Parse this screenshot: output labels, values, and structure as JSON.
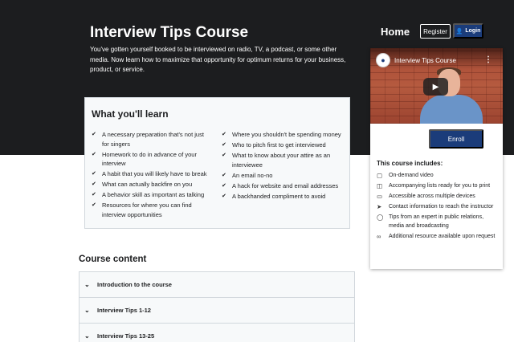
{
  "hero": {
    "title": "Interview Tips Course",
    "description": "You've gotten yourself booked to be interviewed on radio, TV, a podcast, or some other media. Now learn how to maximize that opportunity for optimum returns for your business, product, or service."
  },
  "nav": {
    "home": "Home",
    "register": "Register",
    "login": "Login"
  },
  "learn": {
    "title": "What you'll learn",
    "left": [
      "A necessary preparation that's not just for singers",
      "Homework to do in advance of your interview",
      "A habit that you will likely have to break",
      "What can actually backfire on you",
      "A behavior skill as important as talking",
      "Resources for where you can find interview opportunities"
    ],
    "right": [
      "Where you shouldn't be spending money",
      "Who to pitch first to get interviewed",
      "What to know about your attire as an interviewee",
      "An email no-no",
      "A hack for website and email addresses",
      "A backhanded compliment to avoid"
    ]
  },
  "content": {
    "title": "Course content",
    "sections": [
      "Introduction to the course",
      "Interview Tips 1-12",
      "Interview Tips 13-25"
    ]
  },
  "card": {
    "video_title": "Interview Tips Course",
    "enroll": "Enroll",
    "includes_title": "This course includes:",
    "includes": [
      {
        "icon": "video-icon",
        "text": "On-demand video"
      },
      {
        "icon": "file-icon",
        "text": "Accompanying lists ready for you to print"
      },
      {
        "icon": "devices-icon",
        "text": "Accessible across multiple devices"
      },
      {
        "icon": "send-icon",
        "text": "Contact information to reach the instructor"
      },
      {
        "icon": "lightbulb-icon",
        "text": "Tips from an expert in public relations, media and broadcasting"
      },
      {
        "icon": "link-icon",
        "text": "Additional resource available upon request"
      }
    ]
  },
  "colors": {
    "hero_bg": "#1c1d1f",
    "accent": "#1b3c7a",
    "panel_bg": "#f7f9fa"
  }
}
